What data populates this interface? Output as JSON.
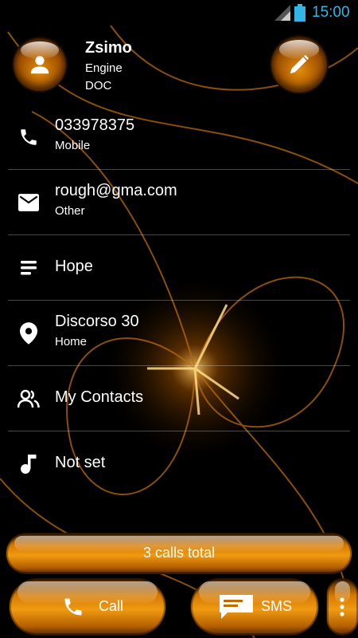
{
  "status_bar": {
    "time": "15:00",
    "accent": "#33b5e5"
  },
  "contact": {
    "name": "Zsimo",
    "title": "Engine",
    "company": "DOC"
  },
  "rows": [
    {
      "icon": "phone-icon",
      "main": "033978375",
      "sub": "Mobile"
    },
    {
      "icon": "email-icon",
      "main": "rough@gma.com",
      "sub": "Other"
    },
    {
      "icon": "note-icon",
      "main": "Hope"
    },
    {
      "icon": "location-icon",
      "main": "Discorso 30",
      "sub": "Home"
    },
    {
      "icon": "group-icon",
      "main": "My Contacts"
    },
    {
      "icon": "music-note-icon",
      "main": "Not set"
    }
  ],
  "calls_summary": "3 calls total",
  "actions": {
    "call_label": "Call",
    "sms_label": "SMS"
  },
  "theme": {
    "accent": "#f09a12",
    "background": "#000000"
  }
}
